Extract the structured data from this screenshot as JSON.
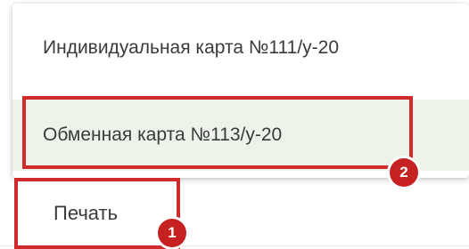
{
  "dropdown": {
    "items": [
      {
        "label": "Индивидуальная карта №111/у-20"
      },
      {
        "label": "Обменная карта №113/у-20",
        "highlighted": true
      }
    ]
  },
  "print_button": {
    "label": "Печать"
  },
  "annotations": {
    "step1": "1",
    "step2": "2"
  },
  "colors": {
    "highlight_border": "#d12a2a",
    "badge_fill": "#c62222",
    "selected_item_bg": "#eef3e9",
    "text": "#3a3a3a"
  }
}
